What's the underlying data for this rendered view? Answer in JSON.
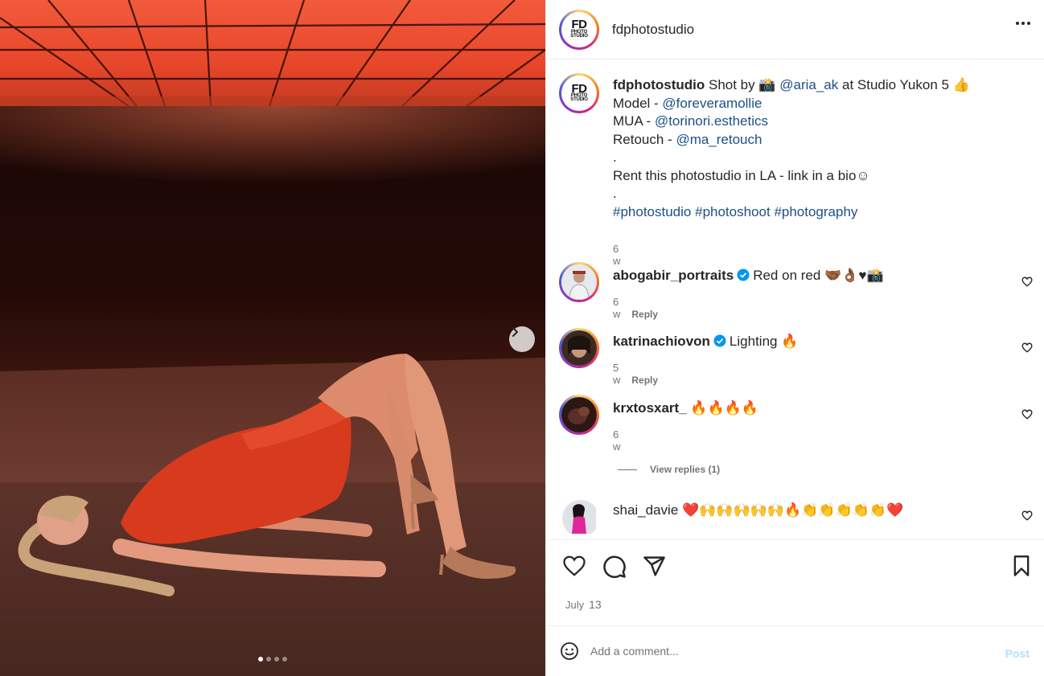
{
  "post": {
    "username": "fdphotostudio",
    "logo_top": "FD",
    "logo_mid": "PHOTO",
    "logo_bot": "STUDIO",
    "caption": {
      "username": "fdphotostudio",
      "line1_pre": "Shot by 📸  ",
      "line1_link": "@aria_ak",
      "line1_post": " at Studio Yukon 5 👍",
      "line2_pre": "Model - ",
      "line2_link": "@foreveramollie",
      "line3_pre": "MUA - ",
      "line3_link": "@torinori.esthetics",
      "line4_pre": "Retouch - ",
      "line4_link": "@ma_retouch",
      "dot1": ".",
      "line5": "Rent this photostudio in LA - link in a bio☺",
      "dot2": ".",
      "tag1": "#photostudio",
      "tag2": "#photoshoot",
      "tag3": "#photography",
      "time": "6 w"
    },
    "media": {
      "slides": 4,
      "active_slide": 1
    },
    "date_month": "July",
    "date_day": "13"
  },
  "comments": [
    {
      "username": "abogabir_portraits",
      "verified": true,
      "text": "Red on red 🤝🏾👌🏾♥📸",
      "time": "6 w",
      "reply": "Reply"
    },
    {
      "username": "katrinachiovon",
      "verified": true,
      "text": "Lighting 🔥",
      "time": "5 w",
      "reply": "Reply"
    },
    {
      "username": "krxtosxart_",
      "verified": false,
      "text": "🔥🔥🔥🔥",
      "time": "6 w",
      "reply": ""
    },
    {
      "username": "shai_davie",
      "verified": false,
      "text": "❤️🙌🙌🙌🙌🙌🔥👏👏👏👏👏❤️",
      "time": "",
      "reply": ""
    }
  ],
  "view_replies": "View replies (1)",
  "add_comment": {
    "placeholder": "Add a comment...",
    "post_label": "Post"
  },
  "colors": {
    "link": "#1e4f86",
    "verified": "#0095f6",
    "post_disabled": "#b2dffc"
  }
}
